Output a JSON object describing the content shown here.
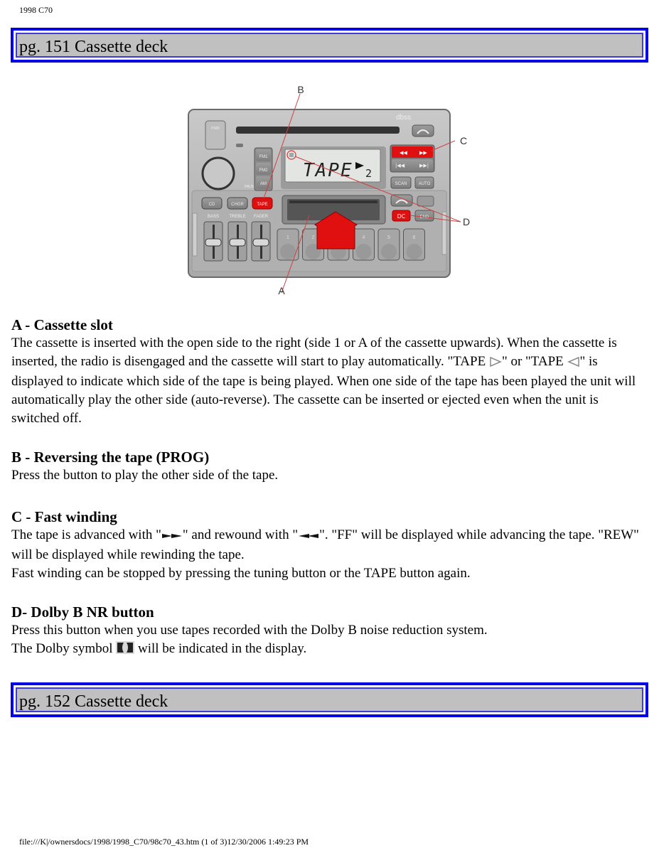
{
  "doc_label": "1998 C70",
  "headers": {
    "top": "pg. 151 Cassette deck",
    "bottom": "pg. 152 Cassette deck"
  },
  "figure": {
    "callouts": {
      "a": "A",
      "b": "B",
      "c": "C",
      "d": "D"
    },
    "display_text": "TAPE",
    "display_side": "2",
    "buttons": {
      "pwr": "PWR",
      "fm1": "FM1",
      "fm2": "FM2",
      "am": "AM",
      "cd": "CD",
      "chgr": "CHGR",
      "tape": "TAPE",
      "scan": "SCAN",
      "auto": "AUTO",
      "end": "END",
      "presets": [
        "1",
        "2",
        "3",
        "4",
        "5",
        "6"
      ]
    },
    "slider_labels": [
      "BASS",
      "TREBLE",
      "FADER"
    ],
    "knob_label": "PAUSE",
    "brand": "dbss",
    "colors": {
      "highlight": "#e01010",
      "panel": "#b4b4b4",
      "callout_line": "#d04040"
    }
  },
  "sections": [
    {
      "title": "A - Cassette slot",
      "paragraphs": [
        {
          "part1": "The cassette is inserted with the open side to the right (side 1 or A of the cassette upwards). When the cassette is inserted, the radio is disengaged and the cassette will start to play automatically. \"TAPE ",
          "icon1": "play-right-outline-icon",
          "part2": "\" or \"TAPE ",
          "icon2": "play-left-outline-icon",
          "part3": "\" is displayed to indicate which side of the tape is being played. When one side of the tape has been played the unit will automatically play the other side (auto-reverse). The cassette can be inserted or ejected even when the unit is switched off."
        }
      ]
    },
    {
      "title": "B - Reversing the tape (PROG)",
      "paragraphs": [
        {
          "text": "Press the button to play the other side of the tape."
        }
      ]
    },
    {
      "title": "C - Fast winding",
      "paragraphs": [
        {
          "part1": "The tape is advanced with \"",
          "icon1": "fast-forward-icon",
          "part2": "\" and rewound with \"",
          "icon2": "rewind-icon",
          "part3": "\". \"FF\" will be displayed while advancing the tape. \"REW\" will be displayed while rewinding the tape."
        },
        {
          "text": "Fast winding can be stopped by pressing the tuning button or the TAPE button again."
        }
      ]
    },
    {
      "title": "D- Dolby B NR button",
      "paragraphs": [
        {
          "text": "Press this button when you use tapes recorded with the Dolby B noise reduction system."
        },
        {
          "part1": "The Dolby symbol ",
          "icon1": "dolby-icon",
          "part2": " will be indicated in the display."
        }
      ]
    }
  ],
  "footer": "file:///K|/ownersdocs/1998/1998_C70/98c70_43.htm (1 of 3)12/30/2006 1:49:23 PM"
}
